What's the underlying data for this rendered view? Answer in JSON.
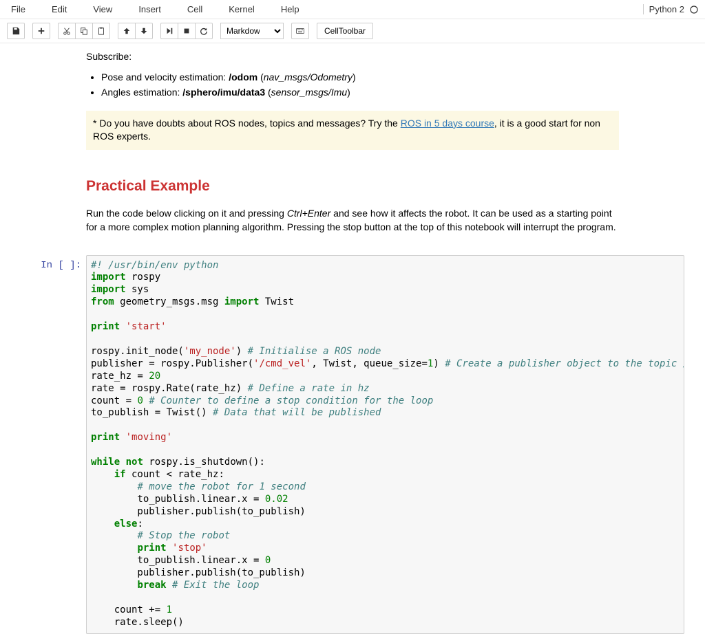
{
  "menu": {
    "file": "File",
    "edit": "Edit",
    "view": "View",
    "insert": "Insert",
    "cell": "Cell",
    "kernel": "Kernel",
    "help": "Help"
  },
  "kernel": {
    "name": "Python 2"
  },
  "toolbar": {
    "cell_type": "Markdown",
    "celltoolbar": "CellToolbar"
  },
  "text": {
    "subscribe": "Subscribe:",
    "list1_prefix": "Pose and velocity estimation: ",
    "list1_topic": "/odom",
    "list1_type": "nav_msgs/Odometry",
    "list2_prefix": "Angles estimation: ",
    "list2_topic": "/sphero/imu/data3",
    "list2_type": "sensor_msgs/Imu",
    "hl_prefix": "* Do you have doubts about ROS nodes, topics and messages? Try the ",
    "hl_link": "ROS in 5 days course",
    "hl_suffix": ", it is a good start for non ROS experts.",
    "heading": "Practical Example",
    "desc_prefix": "Run the code below clicking on it and pressing ",
    "desc_key": "Ctrl+Enter",
    "desc_suffix": " and see how it affects the robot. It can be used as a starting point for a more complex motion planning algorithm. Pressing the stop button at the top of this notebook will interrupt the program."
  },
  "code": {
    "prompt": "In [ ]:",
    "t": {
      "shebang": "#! /usr/bin/env python",
      "import": "import",
      "from": "from",
      "print": "print",
      "if": "if",
      "else": "else",
      "break": "break",
      "while": "while",
      "not": "not",
      "rospy": " rospy",
      "sys": " sys",
      "geom": " geometry_msgs.msg ",
      "twist": " Twist",
      "s_start": "'start'",
      "s_moving": "'moving'",
      "s_stop": "'stop'",
      "s_mynode": "'my_node'",
      "s_cmdvel": "'/cmd_vel'",
      "n_1": "1",
      "n_20": "20",
      "n_0": "0",
      "n_002": "0.02",
      "n_0b": "0",
      "n_1b": "1",
      "c_init": "# Initialise a ROS node",
      "c_pub": "# Create a publisher object to the topic /cmd_vel",
      "c_rate": "# Define a rate in hz",
      "c_count": "# Counter to define a stop condition for the loop",
      "c_data": "# Data that will be published",
      "c_move": "# move the robot for 1 second",
      "c_stop": "# Stop the robot",
      "c_exit": "# Exit the loop",
      "l_init": "rospy.init_node(",
      "l_init2": ") ",
      "l_pub": "publisher = rospy.Publisher(",
      "l_pub2": ", Twist, queue_size=",
      "l_pub3": ") ",
      "l_ratehz": "rate_hz = ",
      "l_rate": "rate = rospy.Rate(rate_hz) ",
      "l_count": "count = ",
      "l_count2": " ",
      "l_topub": "to_publish = Twist() ",
      "l_while": " rospy.is_shutdown():",
      "l_if": " count < rate_hz:",
      "l_else": ":",
      "l_lin1": "        to_publish.linear.x = ",
      "l_pubpub": "        publisher.publish(to_publish)",
      "l_lin0": "        to_publish.linear.x = ",
      "l_count_inc": "    count += ",
      "l_sleep": "    rate.sleep()"
    }
  }
}
